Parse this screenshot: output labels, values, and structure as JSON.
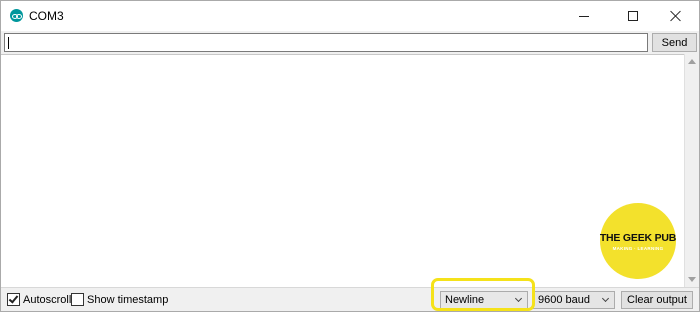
{
  "window": {
    "title": "COM3"
  },
  "input": {
    "value": "",
    "placeholder": ""
  },
  "toolbar": {
    "send_label": "Send"
  },
  "output": {
    "text": ""
  },
  "watermark": {
    "name": "THE GEEK PUB",
    "tagline": "MAKING · LEARNING"
  },
  "footer": {
    "autoscroll_label": "Autoscroll",
    "autoscroll_checked": true,
    "timestamp_label": "Show timestamp",
    "timestamp_checked": false,
    "line_ending": "Newline",
    "baud_rate": "9600 baud",
    "clear_label": "Clear output"
  },
  "colors": {
    "highlight": "#f5e21a",
    "app_icon": "#00979c",
    "logo": "#f3e12c"
  },
  "icons": {
    "app": "arduino-icon",
    "minimize": "minimize-icon",
    "maximize": "maximize-icon",
    "close": "close-icon"
  }
}
